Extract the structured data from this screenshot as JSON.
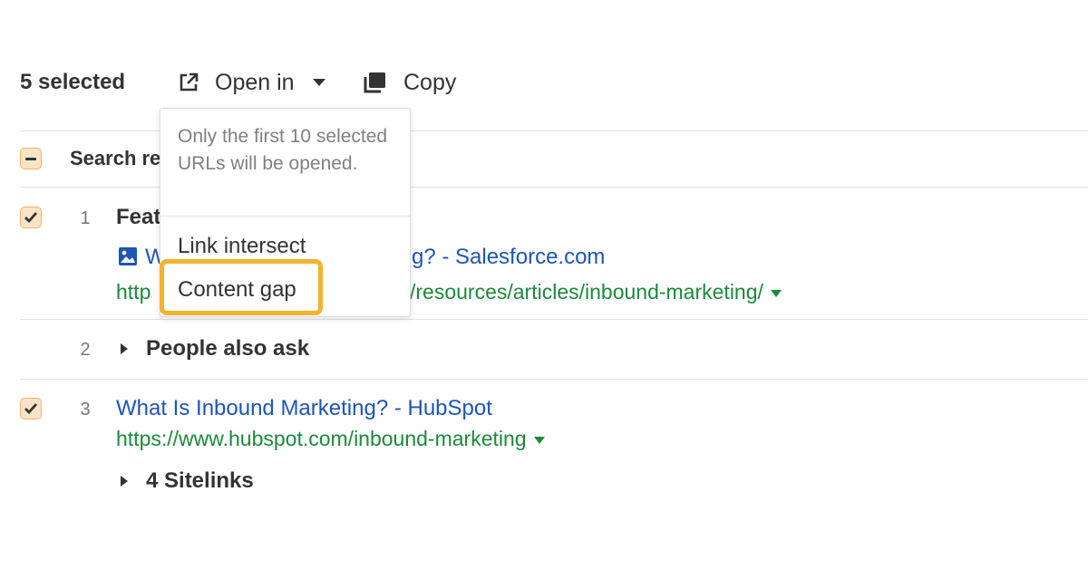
{
  "toolbar": {
    "selected_label": "5 selected",
    "open_in_label": "Open in",
    "copy_label": "Copy"
  },
  "table": {
    "header_label": "Search re"
  },
  "dropdown": {
    "note": "Only the first 10 selected URLs will be opened.",
    "items": [
      {
        "label": "Link intersect"
      },
      {
        "label": "Content gap"
      }
    ]
  },
  "rows": [
    {
      "number": "1",
      "feature_label": "Feat",
      "title_prefix": "W",
      "title_suffix": "g? - Salesforce.com",
      "url_prefix": "http",
      "url_suffix": "/resources/articles/inbound-marketing/"
    },
    {
      "number": "2",
      "label": "People also ask"
    },
    {
      "number": "3",
      "title": "What Is Inbound Marketing? - HubSpot",
      "url": "https://www.hubspot.com/inbound-marketing",
      "sitelinks_label": "4 Sitelinks"
    }
  ],
  "colors": {
    "link_blue": "#1d55b4",
    "url_green": "#1a8a3a",
    "checkbox_orange": "#fbe3c6",
    "highlight_orange": "#f5b22d"
  },
  "icons": [
    "external-link-icon",
    "caret-down-icon",
    "copy-icon",
    "checkbox-indeterminate-icon",
    "checkmark-icon",
    "image-icon",
    "triangle-right-icon"
  ]
}
